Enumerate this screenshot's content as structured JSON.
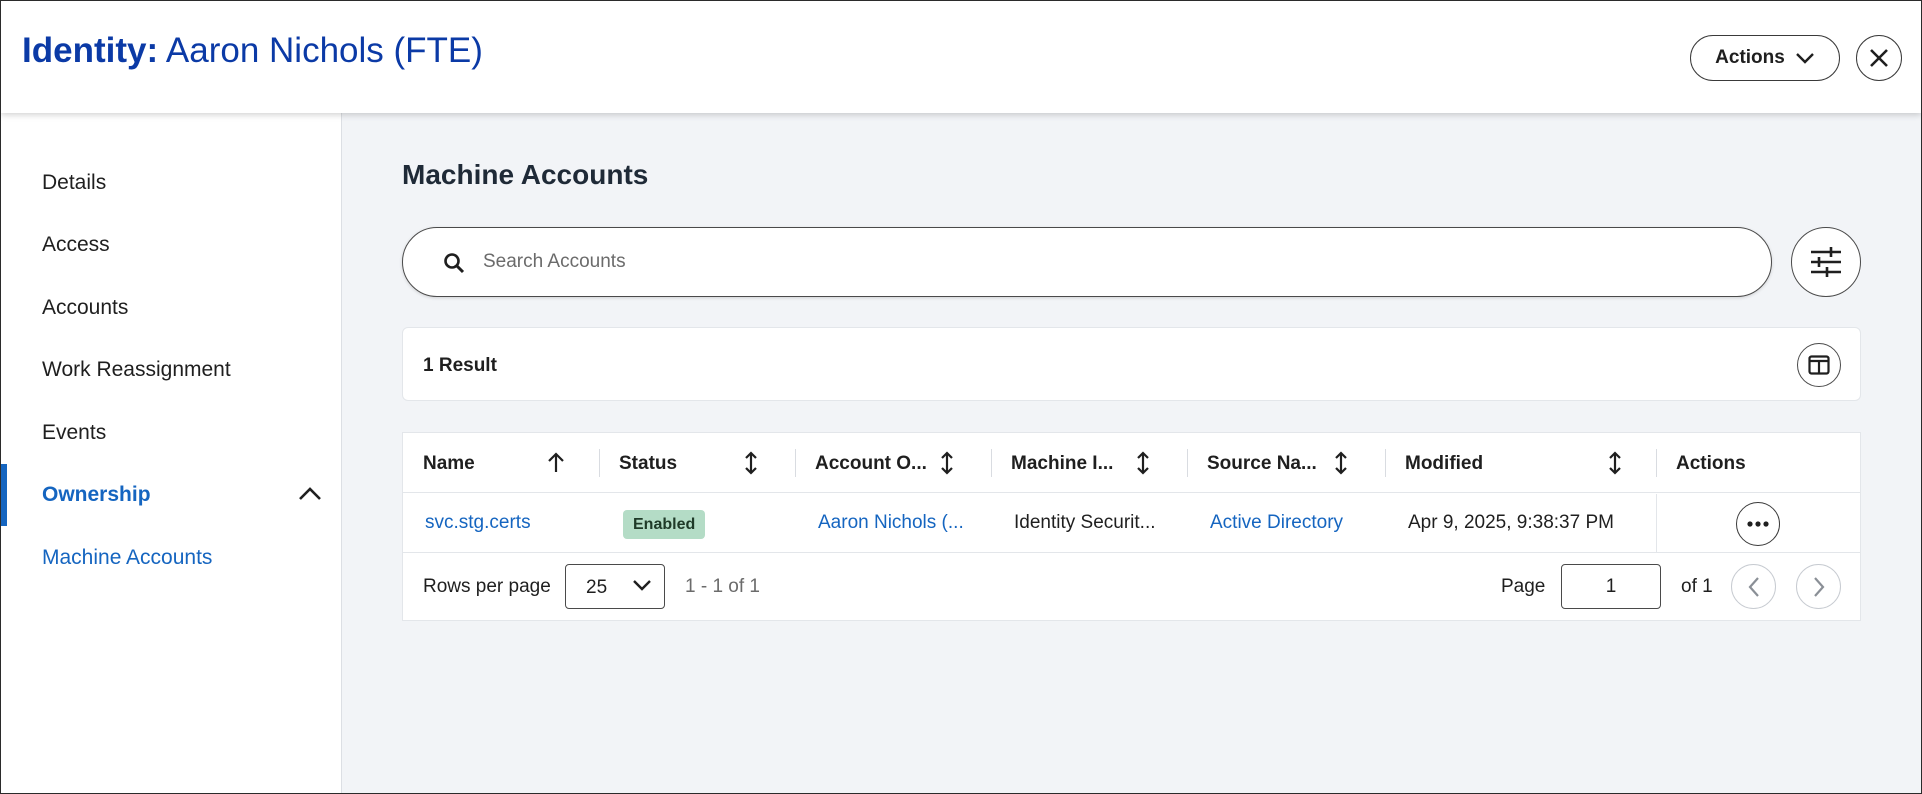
{
  "header": {
    "title_prefix": "Identity:",
    "title_name": "Aaron Nichols (FTE)",
    "actions_label": "Actions"
  },
  "sidebar": {
    "items": [
      {
        "label": "Details"
      },
      {
        "label": "Access"
      },
      {
        "label": "Accounts"
      },
      {
        "label": "Work Reassignment"
      },
      {
        "label": "Events"
      },
      {
        "label": "Ownership"
      },
      {
        "label": "Machine Accounts"
      }
    ],
    "active": "Ownership",
    "active_sub": "Machine Accounts"
  },
  "main": {
    "title": "Machine Accounts",
    "search_placeholder": "Search Accounts",
    "results_count": "1 Result",
    "columns": [
      "Name",
      "Status",
      "Account O...",
      "Machine I...",
      "Source Na...",
      "Modified",
      "Actions"
    ],
    "rows": [
      {
        "name": "svc.stg.certs",
        "status": "Enabled",
        "account_owner": "Aaron Nichols (...",
        "machine_identity": "Identity Securit...",
        "source_name": "Active Directory",
        "modified": "Apr 9, 2025, 9:38:37 PM"
      }
    ],
    "pagination": {
      "rows_per_page_label": "Rows per page",
      "rows_per_page": "25",
      "range": "1 - 1 of 1",
      "page_label": "Page",
      "page": "1",
      "of_pages": "of 1"
    }
  },
  "colors": {
    "brand": "#0b3aa6",
    "link": "#1565c0",
    "badge_enabled": "#b4dcc6",
    "background": "#f2f4f7"
  },
  "icons": [
    "chevron-down-icon",
    "close-icon",
    "chevron-up-icon",
    "search-icon",
    "sliders-icon",
    "columns-icon",
    "sort-asc-icon",
    "sort-icon",
    "ellipsis-icon",
    "chevron-left-icon",
    "chevron-right-icon"
  ]
}
